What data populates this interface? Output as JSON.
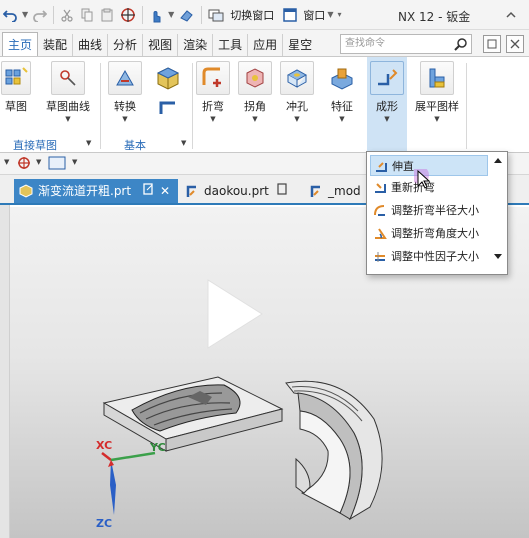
{
  "title_bar": {
    "switch_window": "切换窗口",
    "window_menu": "窗口",
    "app_title": "NX 12 - 钣金"
  },
  "menu_tabs": [
    "主页",
    "装配",
    "曲线",
    "分析",
    "视图",
    "渲染",
    "工具",
    "应用",
    "星空"
  ],
  "search": {
    "placeholder": "查找命令"
  },
  "ribbon": {
    "sketch": "草图",
    "sketch_curve": "草图曲线",
    "convert": "转换",
    "bend": "折弯",
    "corner": "拐角",
    "punch": "冲孔",
    "feature": "特征",
    "form": "成形",
    "flat_pattern": "展平图样",
    "group_direct_sketch": "直接草图",
    "group_basic": "基本"
  },
  "doc_tabs": [
    "渐变流道开粗.prt",
    "daokou.prt",
    "_mod"
  ],
  "form_menu": {
    "items": [
      "伸直",
      "重新折弯",
      "调整折弯半径大小",
      "调整折弯角度大小",
      "调整中性因子大小"
    ]
  },
  "axes": {
    "xc": "XC",
    "yc": "YC",
    "zc": "ZC"
  },
  "colors": {
    "accent": "#2a6cb8",
    "active_tab": "#3d86c6",
    "hover": "#cde4f7"
  }
}
